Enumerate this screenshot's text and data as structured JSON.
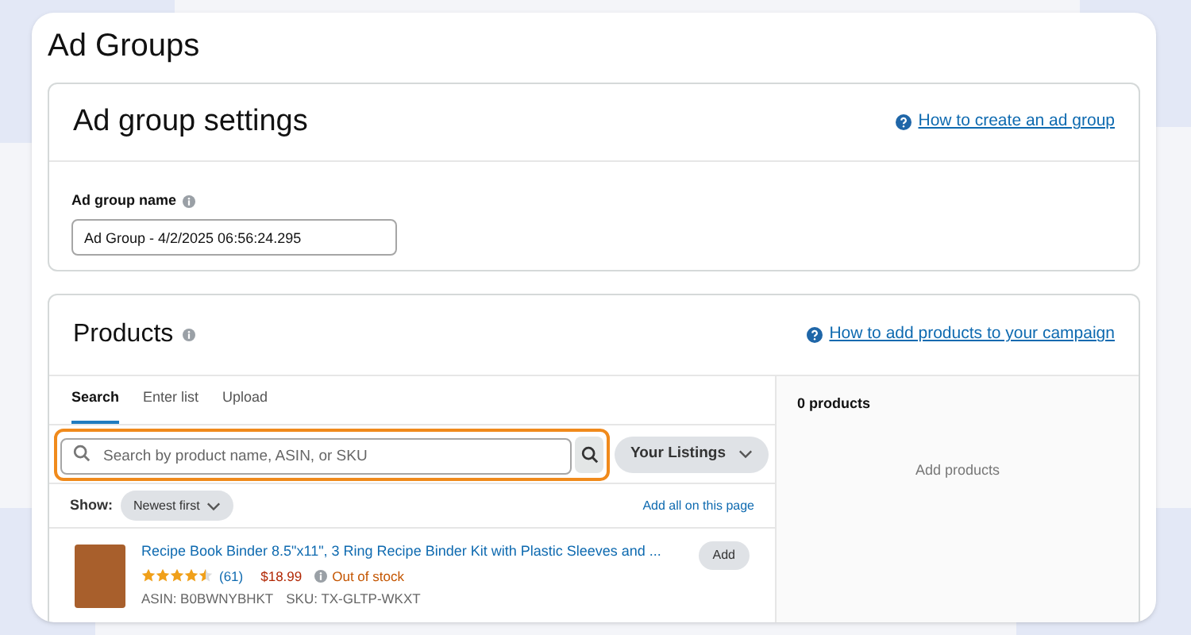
{
  "page_title": "Ad Groups",
  "settings": {
    "title": "Ad group settings",
    "help_link": "How to create an ad group",
    "name_label": "Ad group name",
    "name_value": "Ad Group - 4/2/2025 06:56:24.295"
  },
  "products": {
    "title": "Products",
    "help_link": "How to add products to your campaign",
    "tabs": [
      {
        "label": "Search",
        "selected": true
      },
      {
        "label": "Enter list",
        "selected": false
      },
      {
        "label": "Upload",
        "selected": false
      }
    ],
    "search": {
      "placeholder": "Search by product name, ASIN, or SKU",
      "highlighted": true
    },
    "source_dropdown": "Your Listings",
    "show_label": "Show:",
    "sort_dropdown": "Newest first",
    "add_all_link": "Add all on this page",
    "items": [
      {
        "title": "Recipe Book Binder 8.5\"x11\", 3 Ring Recipe Binder Kit with Plastic Sleeves and ...",
        "stars": 4.5,
        "reviews": "(61)",
        "price": "$18.99",
        "availability": "Out of stock",
        "asin": "ASIN: B0BWNYBHKT",
        "sku": "SKU: TX-GLTP-WKXT",
        "button": "Add"
      }
    ],
    "selected_count": "0 products",
    "empty_text": "Add products"
  }
}
